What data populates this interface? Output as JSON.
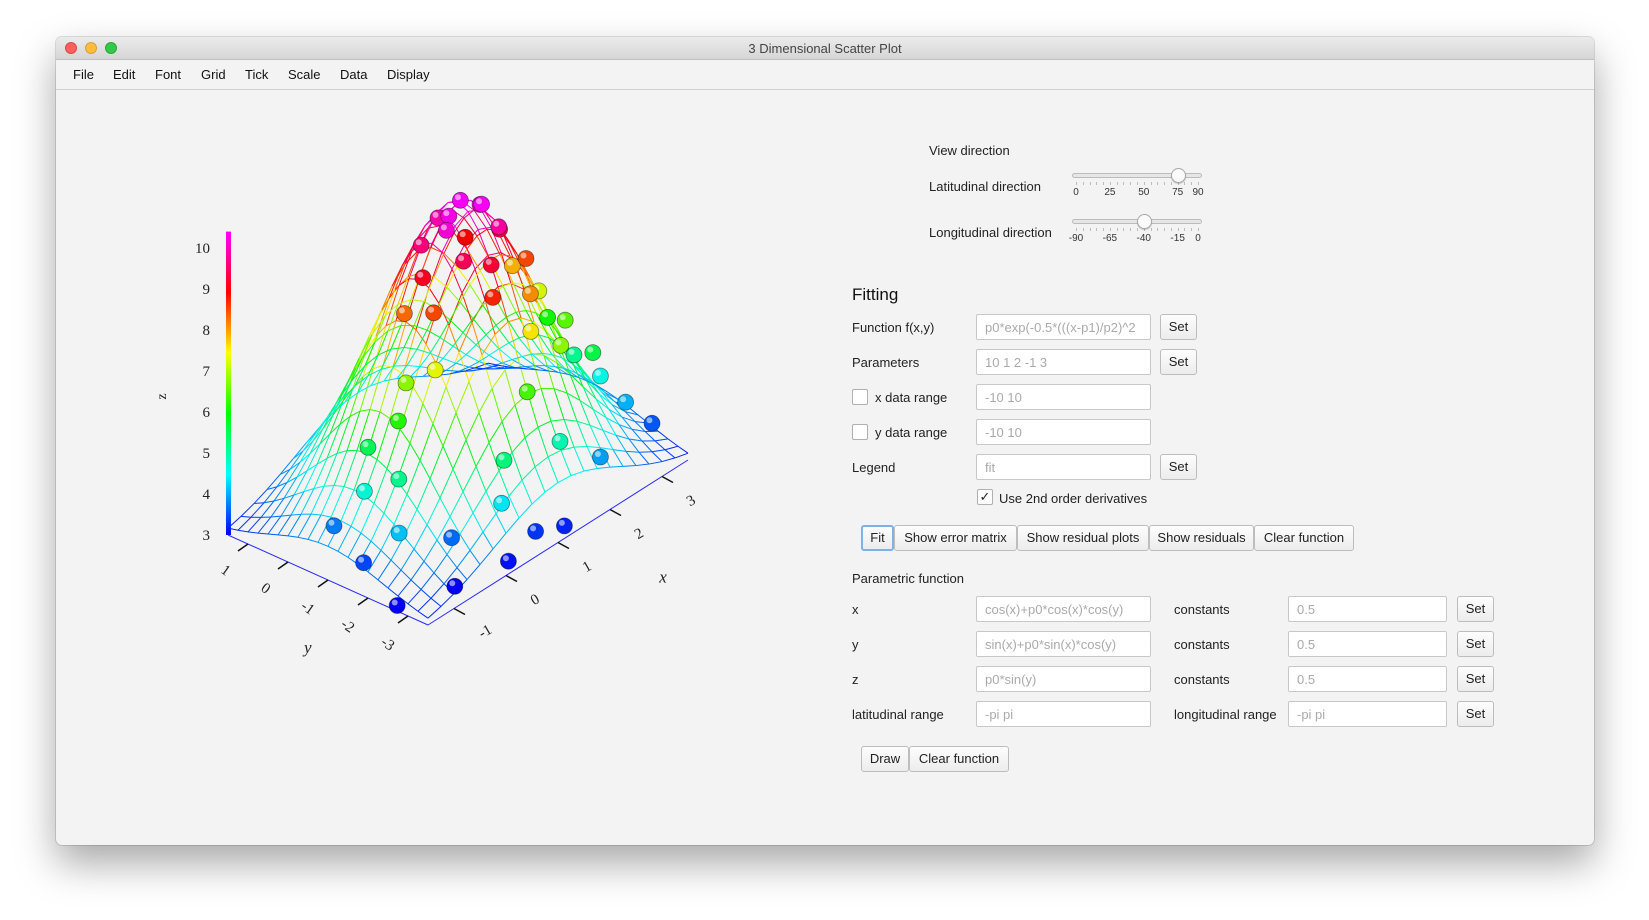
{
  "window": {
    "title": "3 Dimensional Scatter Plot"
  },
  "menu": [
    "File",
    "Edit",
    "Font",
    "Grid",
    "Tick",
    "Scale",
    "Data",
    "Display"
  ],
  "view": {
    "title": "View direction",
    "lat_label": "Latitudinal direction",
    "lat_ticks": [
      "0",
      "25",
      "50",
      "75",
      "90"
    ],
    "lat_value": 75,
    "lon_label": "Longitudinal direction",
    "lon_ticks": [
      "-90",
      "-65",
      "-40",
      "-15",
      "0"
    ],
    "lon_value": -40
  },
  "fitting": {
    "title": "Fitting",
    "function_label": "Function f(x,y)",
    "function_placeholder": "p0*exp(-0.5*(((x-p1)/p2)^2",
    "parameters_label": "Parameters",
    "parameters_placeholder": "10 1 2 -1 3",
    "xrange_label": "x data range",
    "xrange_placeholder": "-10 10",
    "yrange_label": "y data range",
    "yrange_placeholder": "-10 10",
    "legend_label": "Legend",
    "legend_placeholder": "fit",
    "set_label": "Set",
    "use2nd_label": "Use 2nd order derivatives",
    "use2nd_checked": "✓",
    "buttons": {
      "fit": "Fit",
      "error_matrix": "Show error matrix",
      "residual_plots": "Show residual plots",
      "residuals": "Show residuals",
      "clear": "Clear function"
    }
  },
  "parametric": {
    "title": "Parametric function",
    "x_label": "x",
    "x_placeholder": "cos(x)+p0*cos(x)*cos(y)",
    "y_label": "y",
    "y_placeholder": "sin(x)+p0*sin(x)*cos(y)",
    "z_label": "z",
    "z_placeholder": "p0*sin(y)",
    "constants_label": "constants",
    "constants_placeholder": "0.5",
    "lat_range_label": "latitudinal range",
    "lat_range_placeholder": "-pi pi",
    "lon_range_label": "longitudinal range",
    "lon_range_placeholder": "-pi pi",
    "set_label": "Set",
    "draw_label": "Draw",
    "clear_label": "Clear function"
  },
  "chart_data": {
    "type": "scatter",
    "subtype": "3d-scatter-with-surface",
    "zlabel": "z",
    "xlabel": "x",
    "ylabel": "y",
    "z_ticks": [
      "3",
      "4",
      "5",
      "6",
      "7",
      "8",
      "9",
      "10"
    ],
    "x_ticks": [
      "-1",
      "0",
      "1",
      "2",
      "3"
    ],
    "y_ticks": [
      "1",
      "0",
      "-1",
      "-2",
      "-3"
    ],
    "zlim": [
      3,
      10
    ],
    "xlim": [
      -1.5,
      3.5
    ],
    "ylim": [
      -3.5,
      1.5
    ],
    "colormap": "z-value hue (blue → cyan → green → yellow → red → magenta)",
    "surface": {
      "function": "gaussian",
      "amplitude": 7.2,
      "x_center": 1,
      "x_sigma": 1.2,
      "y_center": -1,
      "y_sigma": 1.4,
      "offset": 3
    },
    "points": [
      [
        1.2,
        -0.8,
        10.0
      ],
      [
        0.9,
        -0.9,
        9.9
      ],
      [
        1.3,
        -1.2,
        10.0
      ],
      [
        0.7,
        -1.1,
        9.8
      ],
      [
        1.0,
        -0.5,
        9.6
      ],
      [
        1.5,
        -0.9,
        9.7
      ],
      [
        0.6,
        -0.6,
        9.3
      ],
      [
        1.4,
        -1.5,
        9.5
      ],
      [
        0.8,
        -1.4,
        9.1
      ],
      [
        1.1,
        -1.7,
        8.9
      ],
      [
        0.4,
        -0.9,
        8.8
      ],
      [
        1.8,
        -1.0,
        8.9
      ],
      [
        0.3,
        -1.3,
        8.2
      ],
      [
        1.6,
        -0.4,
        8.6
      ],
      [
        0.9,
        -2.0,
        8.4
      ],
      [
        2.0,
        -1.4,
        8.2
      ],
      [
        0.2,
        -0.7,
        8.0
      ],
      [
        1.7,
        -1.9,
        7.8
      ],
      [
        2.2,
        -0.8,
        7.6
      ],
      [
        0.1,
        -1.6,
        7.1
      ],
      [
        1.4,
        -2.3,
        7.3
      ],
      [
        2.4,
        -1.2,
        7.0
      ],
      [
        0.0,
        -1.0,
        6.6
      ],
      [
        1.9,
        -2.4,
        6.6
      ],
      [
        2.6,
        -1.6,
        6.3
      ],
      [
        -0.3,
        -1.2,
        6.0
      ],
      [
        1.1,
        -2.6,
        6.2
      ],
      [
        2.8,
        -0.9,
        5.9
      ],
      [
        -0.5,
        -0.7,
        5.3
      ],
      [
        0.5,
        -2.8,
        5.1
      ],
      [
        2.9,
        -1.9,
        5.4
      ],
      [
        -0.6,
        -1.6,
        5.0
      ],
      [
        3.0,
        -1.3,
        5.0
      ],
      [
        -0.8,
        -1.0,
        4.6
      ],
      [
        1.5,
        -2.9,
        4.8
      ],
      [
        3.2,
        -1.7,
        4.5
      ],
      [
        -0.9,
        -2.0,
        4.1
      ],
      [
        0.3,
        -3.0,
        4.3
      ],
      [
        3.3,
        -2.2,
        4.0
      ],
      [
        -1.0,
        -0.5,
        3.7
      ],
      [
        -0.2,
        -2.4,
        3.6
      ],
      [
        2.2,
        -3.0,
        3.9
      ],
      [
        3.5,
        -2.6,
        3.5
      ],
      [
        -1.2,
        -1.5,
        3.4
      ],
      [
        0.8,
        -3.2,
        3.3
      ],
      [
        -1.4,
        -2.6,
        3.0
      ],
      [
        -0.6,
        -3.0,
        3.0
      ],
      [
        0.2,
        -3.3,
        3.1
      ],
      [
        1.2,
        -3.4,
        3.2
      ]
    ]
  }
}
